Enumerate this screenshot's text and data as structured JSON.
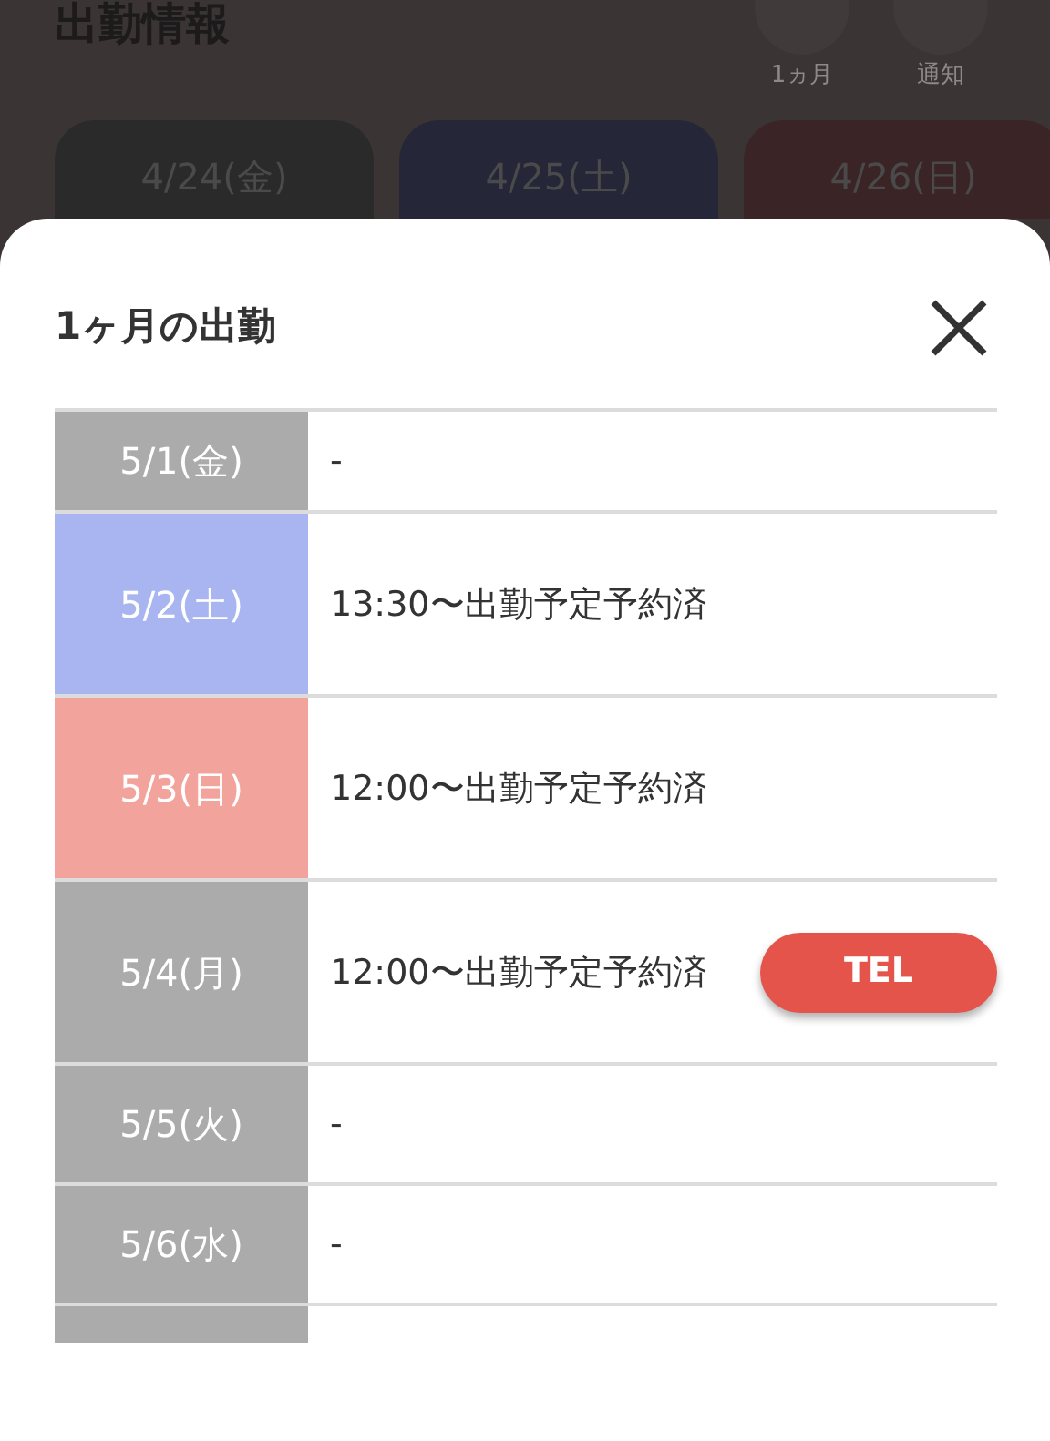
{
  "page": {
    "title": "出勤情報",
    "actions": [
      {
        "label": "1ヵ月"
      },
      {
        "label": "通知"
      }
    ],
    "days": [
      {
        "date": "4/24(金)",
        "kind": "weekday"
      },
      {
        "date": "4/25(土)",
        "kind": "saturday"
      },
      {
        "date": "4/26(日)",
        "kind": "sunday"
      }
    ]
  },
  "modal": {
    "title": "1ヶ月の出勤",
    "rows": [
      {
        "date": "5/1(金)",
        "kind": "weekday",
        "status": "-"
      },
      {
        "date": "5/2(土)",
        "kind": "saturday",
        "status": "13:30〜出勤予定予約済"
      },
      {
        "date": "5/3(日)",
        "kind": "sunday",
        "status": "12:00〜出勤予定予約済"
      },
      {
        "date": "5/4(月)",
        "kind": "weekday",
        "status": "12:00〜出勤予定予約済",
        "button": "TEL"
      },
      {
        "date": "5/5(火)",
        "kind": "weekday",
        "status": "-"
      },
      {
        "date": "5/6(水)",
        "kind": "weekday",
        "status": "-"
      },
      {
        "kind": "weekday"
      }
    ]
  }
}
